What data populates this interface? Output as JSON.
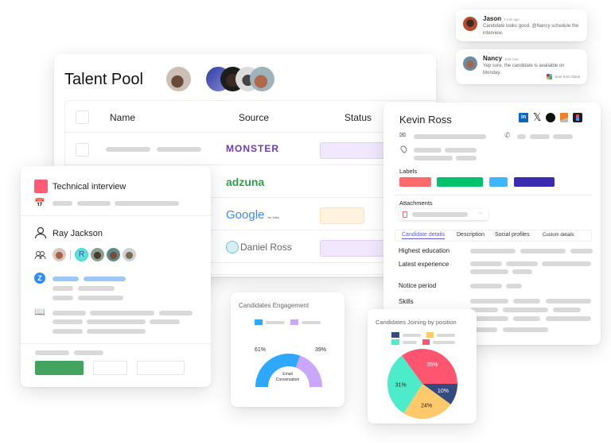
{
  "chat": [
    {
      "name": "Jason",
      "time": "3 min ago",
      "message": "Candidate looks good. @Nancy schedule the interview.",
      "avatar_color": "#b54a2c"
    },
    {
      "name": "Nancy",
      "time": "Just now",
      "message": "Yep sure, the candidate is available on Monday.",
      "avatar_color": "#7c5b4b",
      "footer": "Sent from Slack"
    }
  ],
  "talent_pool": {
    "title": "Talent Pool",
    "columns": [
      "Name",
      "Source",
      "Status"
    ],
    "rows": [
      {
        "source": "MONSTER",
        "source_color": "#6e3bb0",
        "status_color": "#f1e8fd"
      },
      {
        "source": "adzuna",
        "source_color": "#2fa14a",
        "status_color": ""
      },
      {
        "source": "Google",
        "source_sub": "for Jobs",
        "status_color": "#fff3dd"
      },
      {
        "source": "Daniel Ross",
        "status_color": "#f1e8fd"
      }
    ]
  },
  "interview": {
    "title": "Technical interview",
    "accent": "#ff5a78",
    "interviewer": "Ray Jackson",
    "participant_initial": "R",
    "primary_button_color": "#43a460"
  },
  "profile": {
    "name": "Kevin Ross",
    "social_icons": [
      "linkedin-icon",
      "x-icon",
      "github-icon",
      "stackoverflow-icon",
      "figma-icon"
    ],
    "labels_heading": "Labels",
    "label_colors": [
      "#ff6b6b",
      "#00c16e",
      "#3db5ff",
      "#3a2bb0"
    ],
    "attachments_heading": "Attachments",
    "tabs": [
      "Candidate details",
      "Description",
      "Social profiles",
      "Custom details"
    ],
    "active_tab": 0,
    "fields": [
      "Highest education",
      "Latest experience",
      "Notice period",
      "Skills"
    ]
  },
  "engagement": {
    "title": "Candidates Engagement",
    "center_label_1": "Email",
    "center_label_2": "Conversation",
    "left_pct": "61%",
    "right_pct": "39%"
  },
  "position": {
    "title": "Candidates Joining by position"
  },
  "chart_data": [
    {
      "type": "pie",
      "title": "Candidates Engagement",
      "variant": "half-donut",
      "categories": [
        "Email",
        "Conversation"
      ],
      "values": [
        61,
        39
      ],
      "colors": [
        "#2ea7ff",
        "#c9a6ff"
      ],
      "labels": [
        "61%",
        "39%"
      ]
    },
    {
      "type": "pie",
      "title": "Candidates Joining by position",
      "categories": [
        "Navy",
        "Yellow",
        "Teal",
        "Red"
      ],
      "values": [
        10,
        24,
        31,
        35
      ],
      "colors": [
        "#354a7d",
        "#fdc96a",
        "#4ceccb",
        "#ff5570"
      ],
      "labels": [
        "10%",
        "24%",
        "31%",
        "35%"
      ]
    }
  ]
}
